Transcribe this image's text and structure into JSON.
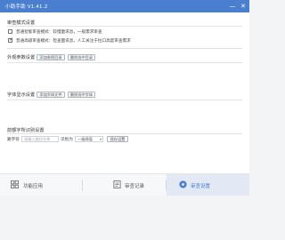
{
  "window": {
    "title": "小助手助 V1.41.2",
    "minimize_label": "—",
    "close_label": "✕"
  },
  "sections": {
    "mode": {
      "title": "审查模式设置",
      "options": [
        {
          "label": "普通智能审查模式：较慢面讯息，一般需求审查",
          "checked": false
        },
        {
          "label": "普通高级审查模式：检查面讯息，人工关注于拉口高度审查需求",
          "checked": true
        }
      ]
    },
    "appearance": {
      "title": "外观参数设置",
      "buttons": [
        "添加参照目录",
        "删除选中目录"
      ]
    },
    "font": {
      "title": "字体显示设置",
      "buttons": [
        "添加字体文件",
        "删除选中字体"
      ]
    },
    "shared": {
      "title": "前额字所识别设置",
      "row_label": "路字符",
      "input_placeholder": "请输入路径名称",
      "mid_label": "识别为",
      "select_value": "一级阈值",
      "save_label": "保存设置"
    }
  },
  "tabs": [
    {
      "label": "功能应用",
      "active": false
    },
    {
      "label": "审查记录",
      "active": false
    },
    {
      "label": "审查设置",
      "active": true
    }
  ],
  "colors": {
    "accent": "#4a7fd0",
    "titlebar": "#4a7fd0",
    "active_tab_bg": "#e2e9f4"
  }
}
